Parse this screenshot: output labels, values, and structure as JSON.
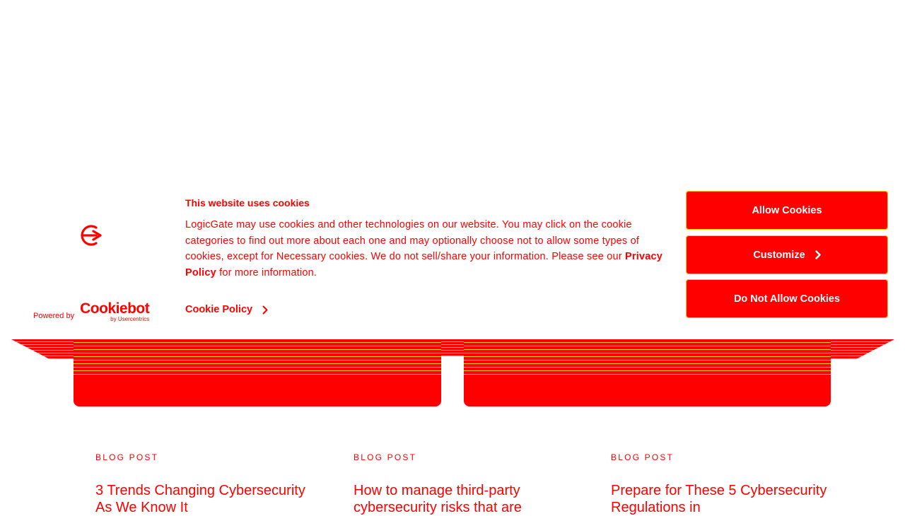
{
  "cookie_banner": {
    "title": "This website uses cookies",
    "text_before_link": "LogicGate may use cookies and other technologies on our website. You may click on the cookie categories to find out more about each one and may optionally choose not to allow some types of cookies, except for Necessary cookies.  We do not sell/share your information. Please see our ",
    "privacy_link": "Privacy Policy",
    "text_after_link": " for more information.",
    "cookie_policy_link": "Cookie Policy",
    "powered_by": "Powered by",
    "cookiebot_name": "Cookiebot",
    "cookiebot_sub": "by Usercentrics",
    "buttons": {
      "allow": "Allow Cookies",
      "customize": "Customize",
      "deny": "Do Not Allow Cookies"
    }
  },
  "posts": [
    {
      "kicker": "BLOG POST",
      "title": "3 Trends Changing Cybersecurity As We Know It"
    },
    {
      "kicker": "BLOG POST",
      "title": "How to manage third-party cybersecurity risks that are"
    },
    {
      "kicker": "BLOG POST",
      "title": "Prepare for These 5 Cybersecurity Regulations in"
    }
  ],
  "colors": {
    "accent": "#ff0000",
    "highlight": "#ffd200",
    "background": "#ffffff"
  },
  "icons": [
    "logicgate-logo-icon",
    "chevron-right-icon"
  ]
}
